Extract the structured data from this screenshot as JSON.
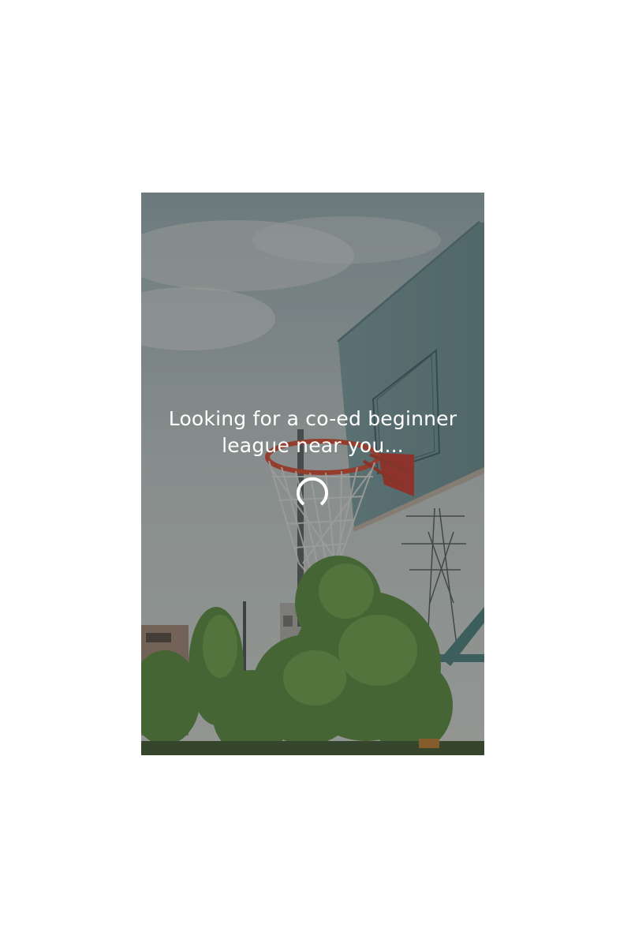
{
  "loading": {
    "message": "Looking for a co-ed beginner league near you..."
  },
  "colors": {
    "overlay": "#282c2c",
    "text": "#ffffff",
    "rim": "#c0392b"
  },
  "icons": {
    "spinner": "loading-spinner-icon"
  }
}
